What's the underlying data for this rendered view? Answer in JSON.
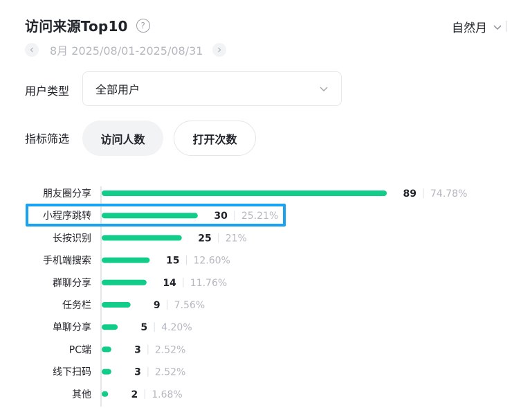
{
  "header": {
    "title": "访问来源Top10",
    "help_icon": "question-circle-icon"
  },
  "period": {
    "label": "自然月",
    "icon": "chevron-down-icon"
  },
  "date_range": {
    "text": "8月 2025/08/01-2025/08/31",
    "prev_icon": "chevron-left-icon",
    "next_icon": "chevron-right-icon"
  },
  "user_type": {
    "label": "用户类型",
    "value": "全部用户",
    "icon": "chevron-down-icon"
  },
  "metric": {
    "label": "指标筛选",
    "options": [
      "访问人数",
      "打开次数"
    ],
    "selected": "访问人数"
  },
  "colors": {
    "bar": "#12cc8a",
    "highlight": "#1aa1ef",
    "muted": "#b4b8bf"
  },
  "chart_data": {
    "type": "bar",
    "orientation": "horizontal",
    "categories": [
      "朋友圈分享",
      "小程序跳转",
      "长按识别",
      "手机端搜索",
      "群聊分享",
      "任务栏",
      "单聊分享",
      "PC端",
      "线下扫码",
      "其他"
    ],
    "values": [
      89,
      30,
      25,
      15,
      14,
      9,
      5,
      3,
      3,
      2
    ],
    "percents": [
      "74.78%",
      "25.21%",
      "21%",
      "12.60%",
      "11.76%",
      "7.56%",
      "4.20%",
      "2.52%",
      "2.52%",
      "1.68%"
    ],
    "highlighted_category": "小程序跳转"
  }
}
